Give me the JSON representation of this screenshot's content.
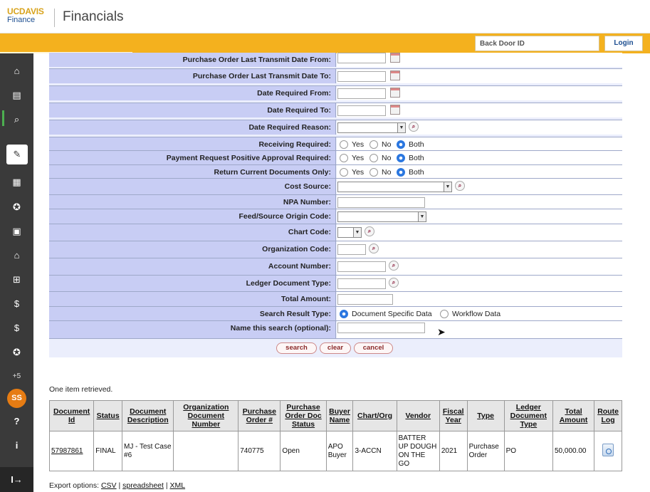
{
  "header": {
    "logo_uc": "UCDAVIS",
    "logo_finance": "Finance",
    "app_title": "Financials",
    "backdoor_placeholder": "Back Door ID",
    "login_label": "Login"
  },
  "sidebar": {
    "icons": [
      "home-icon",
      "clipboard-icon",
      "search-icon",
      "pin-icon",
      "calculator-icon",
      "star-icon",
      "id-card-icon",
      "bank-icon",
      "sitemap-icon",
      "money-hand-icon",
      "money-hand-2-icon",
      "star-circle-icon"
    ],
    "more_label": "+5",
    "avatar_initials": "SS",
    "help_icon": "?",
    "info_icon": "i",
    "logout_icon": "I→"
  },
  "form": {
    "rows": [
      {
        "label": "Purchase Order Last Transmit Date From:"
      },
      {
        "label": "Purchase Order Last Transmit Date To:"
      },
      {
        "label": "Date Required From:"
      },
      {
        "label": "Date Required To:"
      },
      {
        "label": "Date Required Reason:"
      },
      {
        "label": "Receiving Required:"
      },
      {
        "label": "Payment Request Positive Approval Required:"
      },
      {
        "label": "Return Current Documents Only:"
      },
      {
        "label": "Cost Source:"
      },
      {
        "label": "NPA Number:"
      },
      {
        "label": "Feed/Source Origin Code:"
      },
      {
        "label": "Chart Code:"
      },
      {
        "label": "Organization Code:"
      },
      {
        "label": "Account Number:"
      },
      {
        "label": "Ledger Document Type:"
      },
      {
        "label": "Total Amount:"
      },
      {
        "label": "Search Result Type:"
      },
      {
        "label": "Name this search (optional):"
      }
    ],
    "yes_label": "Yes",
    "no_label": "No",
    "both_label": "Both",
    "result_type_doc": "Document Specific Data",
    "result_type_workflow": "Workflow Data",
    "search_label": "search",
    "clear_label": "clear",
    "cancel_label": "cancel"
  },
  "results": {
    "retrieved_text": "One item retrieved.",
    "columns": [
      "Document Id",
      "Status",
      "Document Description",
      "Organization Document Number",
      "Purchase Order #",
      "Purchase Order Doc Status",
      "Buyer Name",
      "Chart/Org",
      "Vendor",
      "Fiscal Year",
      "Type",
      "Ledger Document Type",
      "Total Amount",
      "Route Log"
    ],
    "row": {
      "document_id": "57987861",
      "status": "FINAL",
      "description": "MJ - Test Case #6",
      "org_doc_number": "",
      "po_number": "740775",
      "po_doc_status": "Open",
      "buyer_name": "APO Buyer",
      "chart_org": "3-ACCN",
      "vendor": "BATTER UP DOUGH ON THE GO",
      "fiscal_year": "2021",
      "type": "Purchase Order",
      "ledger_doc_type": "PO",
      "total_amount": "50,000.00"
    },
    "export_prefix": "Export options:",
    "export_csv": "CSV",
    "export_spreadsheet": "spreadsheet",
    "export_xml": "XML"
  }
}
